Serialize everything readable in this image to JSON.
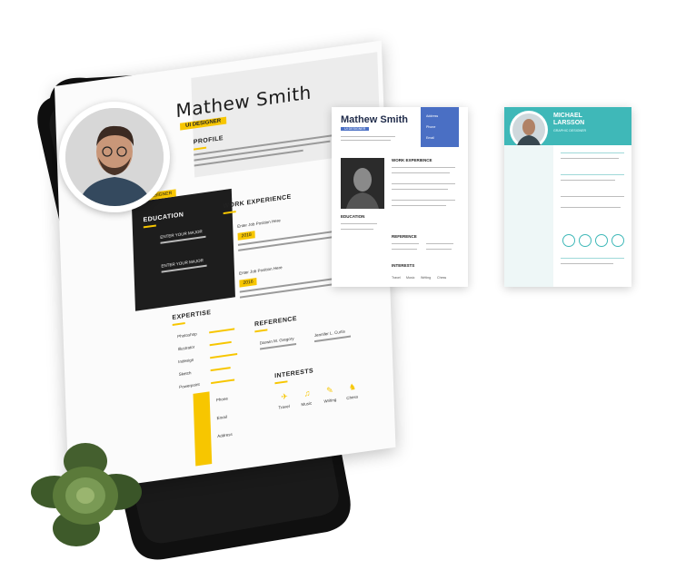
{
  "main_resume": {
    "name": "Mathew Smith",
    "role": "UI DESIGNER",
    "role_badge": "UI DESIGNER",
    "profile_title": "PROFILE",
    "education_title": "EDUCATION",
    "education_items": [
      "ENTER YOUR MAJOR",
      "ENTER YOUR MAJOR"
    ],
    "work_title": "WORK EXPERIENCE",
    "work_items": [
      "Enter Job Position Here",
      "Enter Job Position Here"
    ],
    "work_company_tags": [
      "2018",
      "2016"
    ],
    "expertise_title": "EXPERTISE",
    "expertise_items": [
      "Photoshop",
      "Illustrator",
      "Indesign",
      "Sketch",
      "Powerpoint"
    ],
    "reference_title": "REFERENCE",
    "references": [
      "Darwin M. Gregory",
      "Jennifer L. Curtis"
    ],
    "interests_title": "INTERESTS",
    "interests": [
      "Travel",
      "Music",
      "Writing",
      "Chess"
    ],
    "contact_labels": [
      "Phone",
      "Email",
      "Address"
    ]
  },
  "resume_two": {
    "name": "Mathew Smith",
    "role": "UI DESIGNER",
    "contact_labels": [
      "Address",
      "Phone",
      "Email"
    ],
    "work_title": "WORK EXPERIENCE",
    "education_title": "EDUCATION",
    "reference_title": "REFERENCE",
    "interests_title": "INTERESTS",
    "interests": [
      "Travel",
      "Music",
      "Writing",
      "Chess"
    ],
    "header_color": "#4a6fc4"
  },
  "resume_three": {
    "name_line1": "MICHAEL",
    "name_line2": "LARSSON",
    "role": "GRAPHIC DESIGNER",
    "accent_color": "#3fb8b8"
  },
  "colors": {
    "accent_yellow": "#f7c600",
    "dark_panel": "#1d1d1d"
  }
}
